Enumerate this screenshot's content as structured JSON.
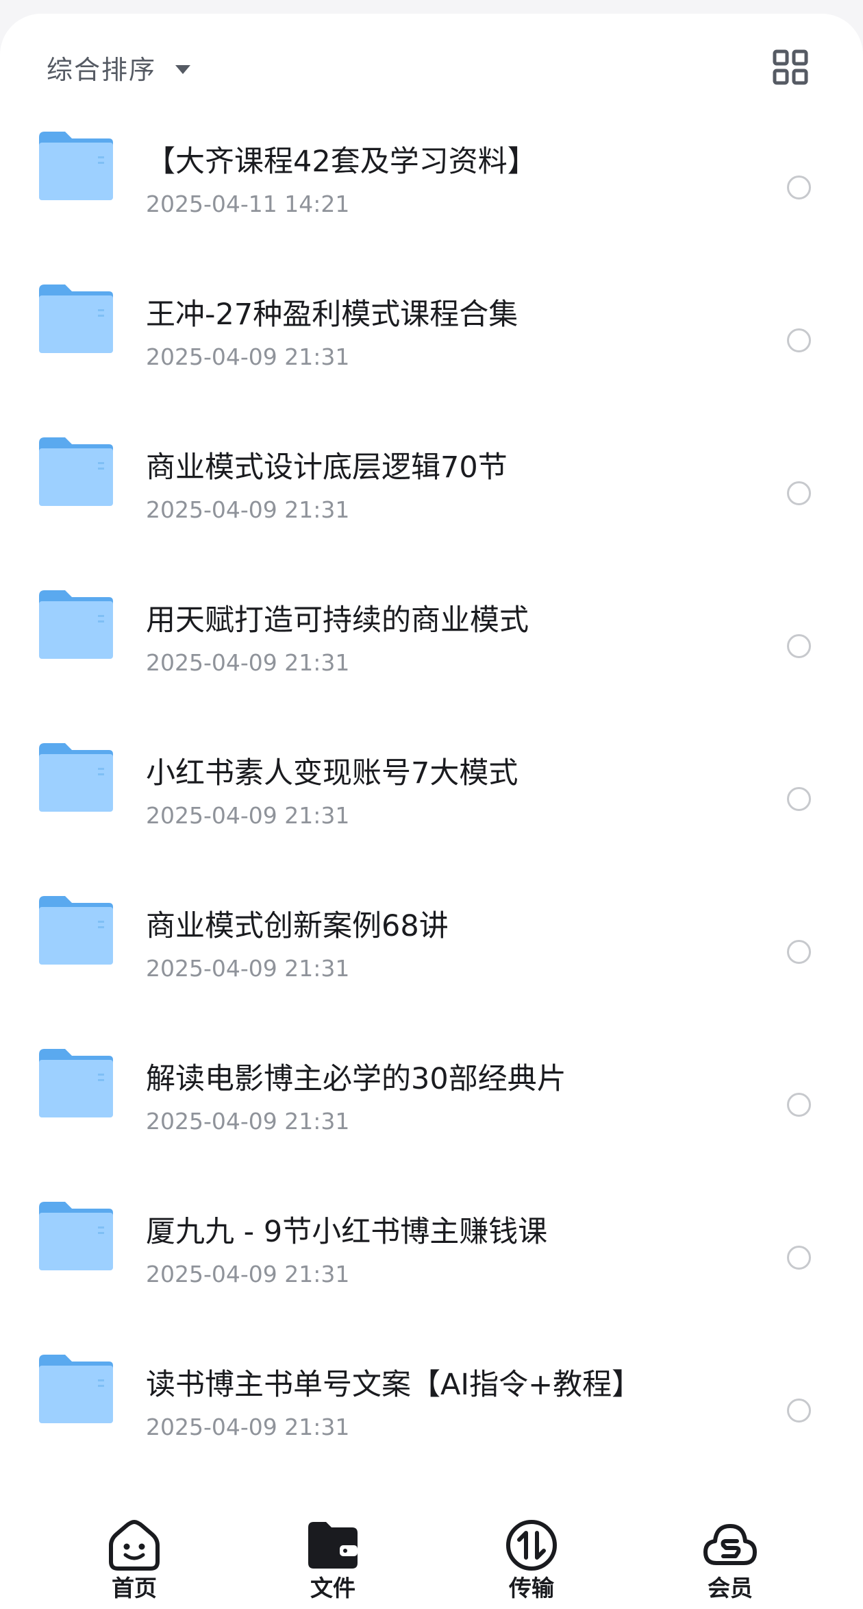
{
  "colors": {
    "folder_back": "#5aa9ef",
    "folder_front": "#9dd0ff",
    "title_text": "#1a1b1f",
    "date_text": "#8f939a",
    "tab_icon": "#1a1b1f"
  },
  "toolbar": {
    "sort_label": "综合排序",
    "sort_icon": "caret-down-icon",
    "view_toggle_icon": "grid-view-icon"
  },
  "files": [
    {
      "name": "【大齐课程42套及学习资料】",
      "date": "2025-04-11 14:21",
      "icon": "folder-icon"
    },
    {
      "name": "王冲-27种盈利模式课程合集",
      "date": "2025-04-09 21:31",
      "icon": "folder-icon"
    },
    {
      "name": "商业模式设计底层逻辑70节",
      "date": "2025-04-09 21:31",
      "icon": "folder-icon"
    },
    {
      "name": "用天赋打造可持续的商业模式",
      "date": "2025-04-09 21:31",
      "icon": "folder-icon"
    },
    {
      "name": "小红书素人变现账号7大模式",
      "date": "2025-04-09 21:31",
      "icon": "folder-icon"
    },
    {
      "name": "商业模式创新案例68讲",
      "date": "2025-04-09 21:31",
      "icon": "folder-icon"
    },
    {
      "name": "解读电影博主必学的30部经典片",
      "date": "2025-04-09 21:31",
      "icon": "folder-icon"
    },
    {
      "name": "厦九九 - 9节小红书博主赚钱课",
      "date": "2025-04-09 21:31",
      "icon": "folder-icon"
    },
    {
      "name": "读书博主书单号文案【AI指令+教程】",
      "date": "2025-04-09 21:31",
      "icon": "folder-icon"
    }
  ],
  "tabbar": {
    "tabs": [
      {
        "label": "首页",
        "icon": "home-face-icon"
      },
      {
        "label": "文件",
        "icon": "files-folder-icon",
        "active": true
      },
      {
        "label": "传输",
        "icon": "transfer-arrows-icon"
      },
      {
        "label": "会员",
        "icon": "cloud-member-icon"
      }
    ]
  }
}
